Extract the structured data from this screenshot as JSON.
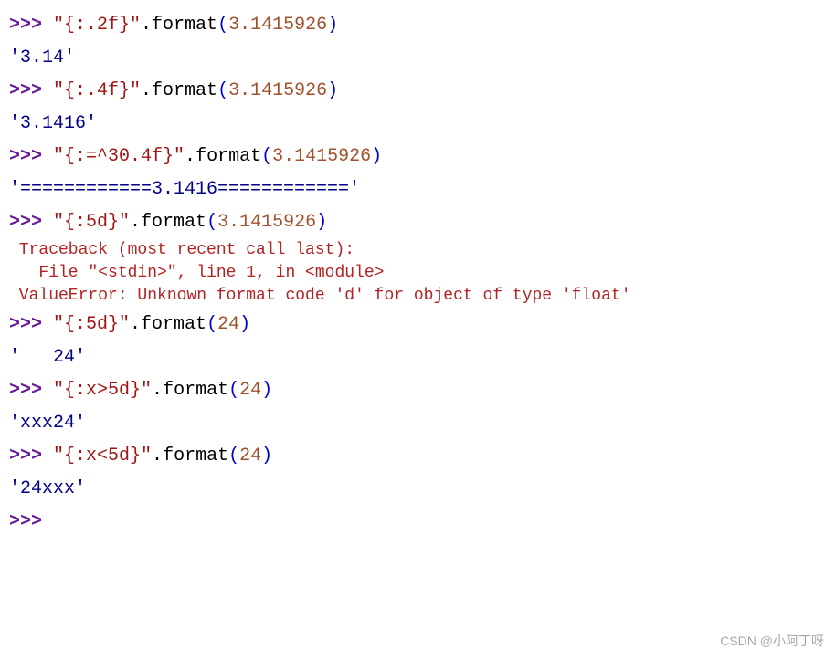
{
  "lines": [
    {
      "prompt": ">>> ",
      "tokens": [
        {
          "t": "\"{:.2f}\"",
          "c": "string"
        },
        {
          "t": ".",
          "c": "dot-call"
        },
        {
          "t": "format",
          "c": "method"
        },
        {
          "t": "(",
          "c": "paren"
        },
        {
          "t": "3.1415926",
          "c": "number"
        },
        {
          "t": ")",
          "c": "paren"
        }
      ]
    },
    {
      "output": "'3.14'"
    },
    {
      "prompt": ">>> ",
      "tokens": [
        {
          "t": "\"{:.4f}\"",
          "c": "string"
        },
        {
          "t": ".",
          "c": "dot-call"
        },
        {
          "t": "format",
          "c": "method"
        },
        {
          "t": "(",
          "c": "paren"
        },
        {
          "t": "3.1415926",
          "c": "number"
        },
        {
          "t": ")",
          "c": "paren"
        }
      ]
    },
    {
      "output": "'3.1416'"
    },
    {
      "prompt": ">>> ",
      "tokens": [
        {
          "t": "\"{:=^30.4f}\"",
          "c": "string"
        },
        {
          "t": ".",
          "c": "dot-call"
        },
        {
          "t": "format",
          "c": "method"
        },
        {
          "t": "(",
          "c": "paren"
        },
        {
          "t": "3.1415926",
          "c": "number"
        },
        {
          "t": ")",
          "c": "paren"
        }
      ]
    },
    {
      "output": "'============3.1416============'"
    },
    {
      "prompt": ">>> ",
      "tokens": [
        {
          "t": "\"{:5d}\"",
          "c": "string"
        },
        {
          "t": ".",
          "c": "dot-call"
        },
        {
          "t": "format",
          "c": "method"
        },
        {
          "t": "(",
          "c": "paren"
        },
        {
          "t": "3.1415926",
          "c": "number"
        },
        {
          "t": ")",
          "c": "paren"
        }
      ]
    },
    {
      "error": " Traceback (most recent call last):"
    },
    {
      "error": "   File \"<stdin>\", line 1, in <module>"
    },
    {
      "error": " ValueError: Unknown format code 'd' for object of type 'float'"
    },
    {
      "prompt": ">>> ",
      "tokens": [
        {
          "t": "\"{:5d}\"",
          "c": "string"
        },
        {
          "t": ".",
          "c": "dot-call"
        },
        {
          "t": "format",
          "c": "method"
        },
        {
          "t": "(",
          "c": "paren"
        },
        {
          "t": "24",
          "c": "number"
        },
        {
          "t": ")",
          "c": "paren"
        }
      ]
    },
    {
      "output": "'   24'"
    },
    {
      "prompt": ">>> ",
      "tokens": [
        {
          "t": "\"{:x>5d}\"",
          "c": "string"
        },
        {
          "t": ".",
          "c": "dot-call"
        },
        {
          "t": "format",
          "c": "method"
        },
        {
          "t": "(",
          "c": "paren"
        },
        {
          "t": "24",
          "c": "number"
        },
        {
          "t": ")",
          "c": "paren"
        }
      ]
    },
    {
      "output": "'xxx24'"
    },
    {
      "prompt": ">>> ",
      "tokens": [
        {
          "t": "\"{:x<5d}\"",
          "c": "string"
        },
        {
          "t": ".",
          "c": "dot-call"
        },
        {
          "t": "format",
          "c": "method"
        },
        {
          "t": "(",
          "c": "paren"
        },
        {
          "t": "24",
          "c": "number"
        },
        {
          "t": ")",
          "c": "paren"
        }
      ]
    },
    {
      "output": "'24xxx'"
    },
    {
      "prompt": ">>> ",
      "tokens": []
    }
  ],
  "watermark": "CSDN @小阿丁呀"
}
